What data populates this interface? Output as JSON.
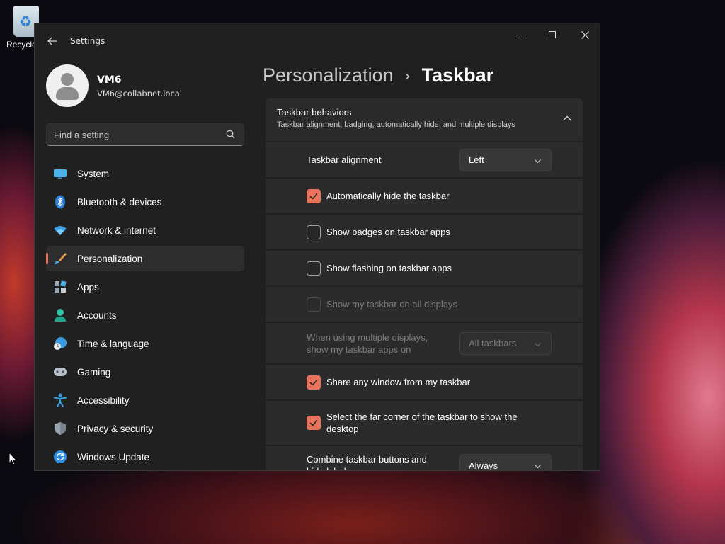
{
  "desktop": {
    "recycle_label": "Recycle"
  },
  "window": {
    "title": "Settings"
  },
  "profile": {
    "name": "VM6",
    "email": "VM6@collabnet.local"
  },
  "search": {
    "placeholder": "Find a setting"
  },
  "nav": {
    "items": [
      {
        "label": "System",
        "icon": "monitor-icon"
      },
      {
        "label": "Bluetooth & devices",
        "icon": "bluetooth-icon"
      },
      {
        "label": "Network & internet",
        "icon": "wifi-icon"
      },
      {
        "label": "Personalization",
        "icon": "brush-icon",
        "active": true
      },
      {
        "label": "Apps",
        "icon": "apps-icon"
      },
      {
        "label": "Accounts",
        "icon": "person-icon"
      },
      {
        "label": "Time & language",
        "icon": "globe-clock-icon"
      },
      {
        "label": "Gaming",
        "icon": "controller-icon"
      },
      {
        "label": "Accessibility",
        "icon": "accessibility-icon"
      },
      {
        "label": "Privacy & security",
        "icon": "shield-icon"
      },
      {
        "label": "Windows Update",
        "icon": "update-icon"
      }
    ]
  },
  "breadcrumb": {
    "parent": "Personalization",
    "separator": "›",
    "current": "Taskbar"
  },
  "section": {
    "title": "Taskbar behaviors",
    "subtitle": "Taskbar alignment, badging, automatically hide, and multiple displays"
  },
  "settings": {
    "alignment_label": "Taskbar alignment",
    "alignment_value": "Left",
    "auto_hide_label": "Automatically hide the taskbar",
    "badges_label": "Show badges on taskbar apps",
    "flashing_label": "Show flashing on taskbar apps",
    "all_displays_label": "Show my taskbar on all displays",
    "multi_display_label_1": "When using multiple displays,",
    "multi_display_label_2": "show my taskbar apps on",
    "multi_display_value": "All taskbars",
    "share_window_label": "Share any window from my taskbar",
    "far_corner_label_1": "Select the far corner of the taskbar to show the",
    "far_corner_label_2": "desktop",
    "combine_label_1": "Combine taskbar buttons and",
    "combine_label_2": "hide labels",
    "combine_value": "Always"
  },
  "colors": {
    "accent": "#e8745e",
    "window_bg": "#202020",
    "card_bg": "#2b2b2b"
  }
}
